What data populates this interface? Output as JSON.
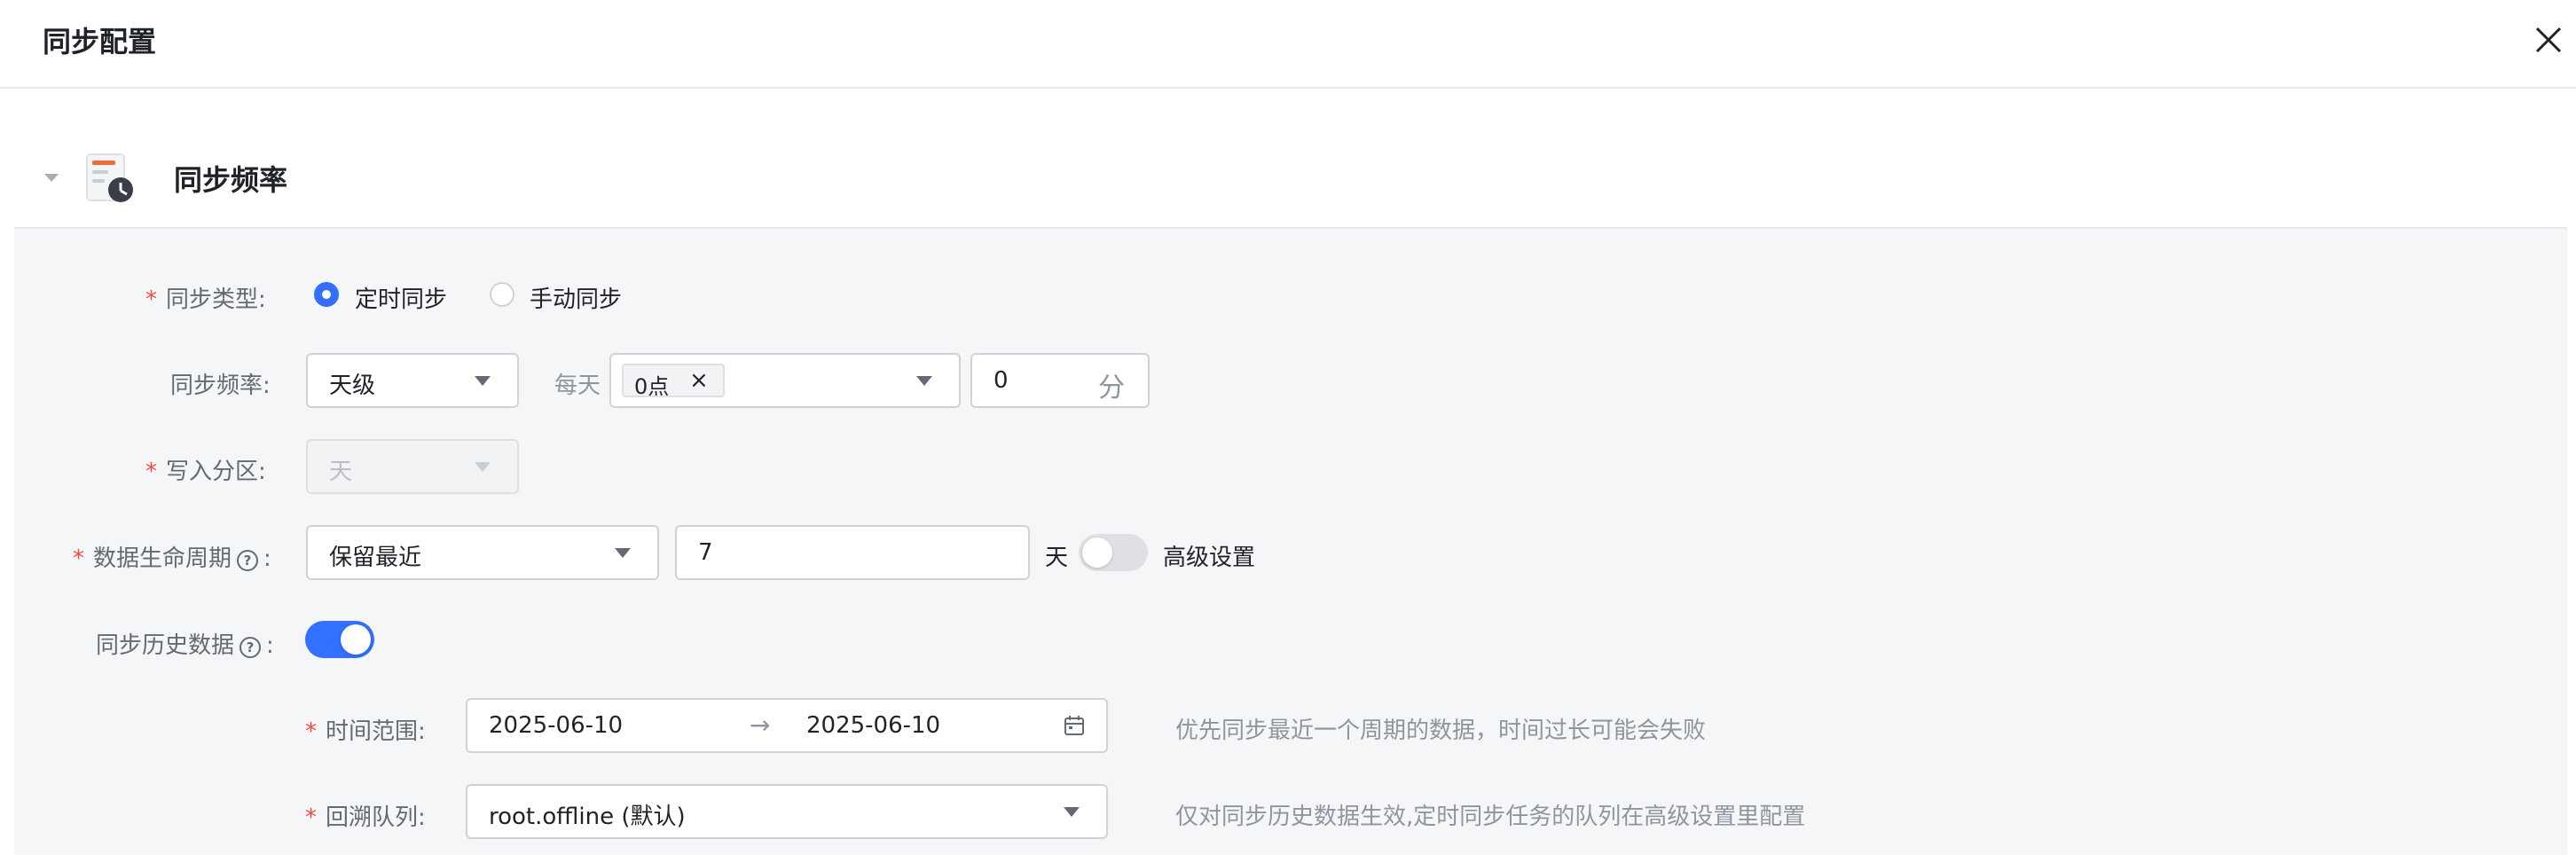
{
  "dialog": {
    "title": "同步配置",
    "close_icon": "close-icon"
  },
  "section": {
    "title": "同步频率",
    "icon": "schedule-clock-icon",
    "collapse_icon": "caret-down-icon"
  },
  "form": {
    "sync_type": {
      "label": "同步类型:",
      "options": [
        {
          "label": "定时同步",
          "selected": true
        },
        {
          "label": "手动同步",
          "selected": false
        }
      ]
    },
    "sync_frequency": {
      "label": "同步频率:",
      "period_value": "天级",
      "every_label": "每天",
      "hour_tag": "0点",
      "tag_remove": "×",
      "minute_value": "0",
      "minute_unit": "分"
    },
    "write_partition": {
      "label": "写入分区:",
      "value": "天",
      "disabled": true
    },
    "data_lifecycle": {
      "label": "数据生命周期",
      "colon": ":",
      "help": "?",
      "policy_value": "保留最近",
      "days_value": "7",
      "days_unit": "天",
      "advanced_toggle_on": false,
      "advanced_label": "高级设置"
    },
    "sync_history": {
      "label": "同步历史数据",
      "colon": ":",
      "help": "?",
      "toggle_on": true
    },
    "time_range": {
      "label": "时间范围:",
      "start": "2025-06-10",
      "separator": "→",
      "end": "2025-06-10",
      "hint": "优先同步最近一个周期的数据，时间过长可能会失败"
    },
    "backfill_queue": {
      "label": "回溯队列:",
      "value": "root.offline (默认)",
      "hint": "仅对同步历史数据生效,定时同步任务的队列在高级设置里配置"
    }
  },
  "colors": {
    "accent": "#3370ff",
    "required": "#f54a45",
    "panel_bg": "#f5f6f8"
  }
}
